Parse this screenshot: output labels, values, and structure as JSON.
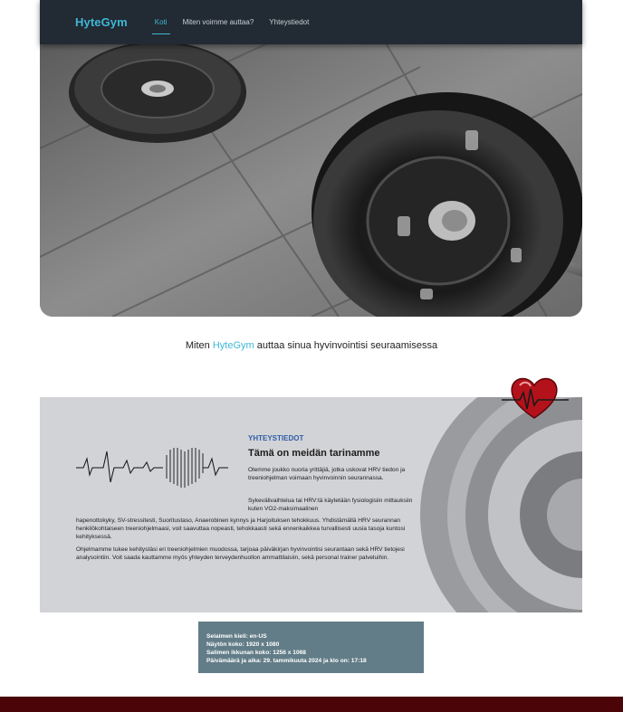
{
  "header": {
    "brand": "HyteGym",
    "nav": [
      {
        "label": "Koti",
        "active": true
      },
      {
        "label": "Miten voimme auttaa?",
        "active": false
      },
      {
        "label": "Yhteystiedot",
        "active": false
      }
    ]
  },
  "hero": {
    "image_alt": "barbell-with-weight-plates"
  },
  "tagline": {
    "prefix": "Miten",
    "brand": "HyteGym",
    "suffix": "auttaa sinua hyvinvointisi seuraamisessa"
  },
  "info": {
    "label": "YHTEYSTIEDOT",
    "title": "Tämä on meidän tarinamme",
    "p1": "Olemme joukko nuoria yrittäjiä, jotka uskovat HRV tiedon ja treeniohjelman voimaan hyvinvoinnin seurannassa.",
    "p2": "Sykevälivaihtelua tai HRV:tä käytetään fysiologisiin mittauksiin kuten VO2-maksimaalinen",
    "p2b": "hapenottokyky, SV-stressitesti, Suoritustaso, Anaerobinen kynnys ja Harjoituksen tehokkuus. Yhdistämällä HRV seurannan henkilökohtaiseen treeniohjelmaasi, voit saavuttaa nopeasti, tehokkaasti sekä ennenkaikkea turvallisesti uusia tasoja kuntosi kehityksessä.",
    "p3": "Ohjelmamme tukee kehitystäsi eri treeniohjelmien muodossa, tarjoaa päiväkirjan hyvinvointisi seurantaan sekä HRV tietojesi analysointiin. Voit saada kauttamme myös yhteyden terveydenhuollon ammattilaisiin, sekä personal trainer palveluihin."
  },
  "browser_info": {
    "language": "Selaimen kieli: en-US",
    "screen": "Näytön koko: 1920 x 1080",
    "window": "Salimen ikkunan koko: 1256 x 1068",
    "datetime": "Päivämäärä ja aika: 29. tammikuuta 2024 ja klo on: 17:18"
  },
  "colors": {
    "accent": "#3fb8d6",
    "navbar": "#222a33",
    "label": "#2f5ea8",
    "info_box": "#627d87",
    "footer": "#4b0407",
    "heart": "#b3121b"
  }
}
